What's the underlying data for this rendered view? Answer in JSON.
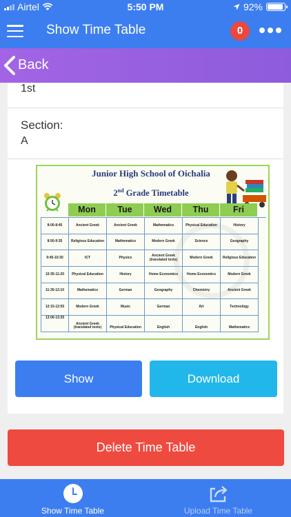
{
  "status_bar": {
    "carrier": "Airtel",
    "time": "5:50 PM",
    "battery": "92%",
    "battery_level": 0.92
  },
  "header": {
    "title": "Show Time Table",
    "notification_count": "0"
  },
  "back": {
    "label": "Back"
  },
  "details": {
    "class_value": "1st",
    "section_label": "Section:",
    "section_value": "A"
  },
  "timetable": {
    "school": "Junior High School of Oichalia",
    "grade_prefix": "2",
    "grade_sup": "nd",
    "grade_suffix": " Grade Timetable",
    "days": [
      "Mon",
      "Tue",
      "Wed",
      "Thu",
      "Fri"
    ],
    "rows": [
      {
        "time": "8:00-8:45",
        "cells": [
          "Ancient Greek",
          "Ancient Greek",
          "Mathematics",
          "Physical Education",
          "History"
        ]
      },
      {
        "time": "8:50-9:35",
        "cells": [
          "Religious Education",
          "Mathematics",
          "Modern Greek",
          "Science",
          "Geography"
        ]
      },
      {
        "time": "9:45-10:30",
        "cells": [
          "ICT",
          "Physics",
          "Ancient Greek (translated texts)",
          "Modern Greek",
          "Religious Education"
        ]
      },
      {
        "time": "10:35-11:20",
        "cells": [
          "Physical Education",
          "History",
          "Home Economics",
          "Home Economics",
          "Modern Greek"
        ]
      },
      {
        "time": "11:30-12:10",
        "cells": [
          "Mathematics",
          "German",
          "Geography",
          "Chemistry",
          "Ancient Greek"
        ]
      },
      {
        "time": "12:15-12:55",
        "cells": [
          "Modern Greek",
          "Music",
          "German",
          "Art",
          "Technology"
        ]
      },
      {
        "time": "13:00-13:35",
        "cells": [
          "Ancient Greek (translated texts)",
          "Physical Education",
          "English",
          "English",
          "Mathematics"
        ]
      }
    ]
  },
  "actions": {
    "show": "Show",
    "download": "Download",
    "delete": "Delete Time Table"
  },
  "tabs": [
    {
      "label": "Show Time Table",
      "icon": "clock-icon",
      "active": true
    },
    {
      "label": "Upload Time Table",
      "icon": "share-icon",
      "active": false
    }
  ],
  "colors": {
    "primary": "#3c7ef0",
    "back_bar": "#9a61e2",
    "download": "#22b7ea",
    "delete": "#ef4a3f",
    "badge": "#e9493f"
  }
}
